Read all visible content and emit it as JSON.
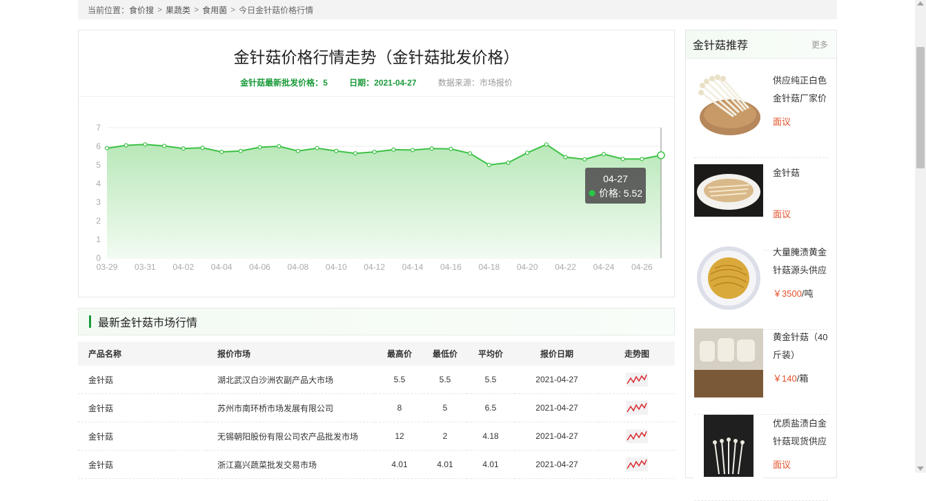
{
  "breadcrumb": {
    "prefix": "当前位置：",
    "items": [
      "食价搜",
      "果蔬类",
      "食用菌",
      "今日金针菇价格行情"
    ],
    "separator": ">"
  },
  "chart_panel": {
    "title": "金针菇价格行情走势（金针菇批发价格）",
    "latest_label": "金针菇最新批发价格：5",
    "date_label": "日期：2021-04-27",
    "source_label": "数据来源：市场报价"
  },
  "chart_data": {
    "type": "area",
    "x": [
      "03-29",
      "03-30",
      "03-31",
      "04-01",
      "04-02",
      "04-03",
      "04-04",
      "04-05",
      "04-06",
      "04-07",
      "04-08",
      "04-09",
      "04-10",
      "04-11",
      "04-12",
      "04-13",
      "04-14",
      "04-15",
      "04-16",
      "04-17",
      "04-18",
      "04-19",
      "04-20",
      "04-21",
      "04-22",
      "04-23",
      "04-24",
      "04-25",
      "04-26",
      "04-27"
    ],
    "x_tick_labels": [
      "03-29",
      "03-31",
      "04-02",
      "04-04",
      "04-06",
      "04-08",
      "04-10",
      "04-12",
      "04-14",
      "04-16",
      "04-18",
      "04-20",
      "04-22",
      "04-24",
      "04-26"
    ],
    "series": [
      {
        "values": [
          5.9,
          6.05,
          6.1,
          6.02,
          5.88,
          5.92,
          5.7,
          5.75,
          5.95,
          6.0,
          5.75,
          5.9,
          5.75,
          5.62,
          5.7,
          5.82,
          5.8,
          5.88,
          5.86,
          5.62,
          5.0,
          5.12,
          5.65,
          6.1,
          5.42,
          5.3,
          5.58,
          5.32,
          5.32,
          5.52
        ]
      }
    ],
    "ylim": [
      0,
      7
    ],
    "y_ticks": [
      0,
      1,
      2,
      3,
      4,
      5,
      6,
      7
    ],
    "grid": true,
    "tooltip": {
      "date": "04-27",
      "label": "价格: 5.52"
    },
    "colors": {
      "line": "#3bc144",
      "fill_top": "#b9e8b9",
      "fill_bottom": "#f2fbf2",
      "tooltip_bg": "#5a5a5a",
      "tooltip_dot": "#28c745"
    }
  },
  "market": {
    "title": "最新金针菇市场行情",
    "columns": [
      "产品名称",
      "报价市场",
      "最高价",
      "最低价",
      "平均价",
      "报价日期",
      "走势图"
    ],
    "rows": [
      [
        "金针菇",
        "湖北武汉白沙洲农副产品大市场",
        "5.5",
        "5.5",
        "5.5",
        "2021-04-27"
      ],
      [
        "金针菇",
        "苏州市南环桥市场发展有限公司",
        "8",
        "5",
        "6.5",
        "2021-04-27"
      ],
      [
        "金针菇",
        "无锡朝阳股份有限公司农产品批发市场",
        "12",
        "2",
        "4.18",
        "2021-04-27"
      ],
      [
        "金针菇",
        "浙江嘉兴蔬菜批发交易市场",
        "4.01",
        "4.01",
        "4.01",
        "2021-04-27"
      ]
    ],
    "trend_icon": "trend-chart-icon"
  },
  "sidebar": {
    "title": "金针菇推荐",
    "more": "更多",
    "products": [
      {
        "name": "供应纯正白色金针菇厂家价",
        "price": "面议",
        "unit": "",
        "image_icon": "enoki-basket-image"
      },
      {
        "name": "金针菇",
        "price": "面议",
        "unit": "",
        "image_icon": "enoki-plate-image"
      },
      {
        "name": "大量腌渍黄金针菇源头供应",
        "price": "￥3500",
        "unit": "/吨",
        "image_icon": "pickled-enoki-image"
      },
      {
        "name": "黄金针菇（40斤装）",
        "price": "￥140",
        "unit": "/箱",
        "image_icon": "boxed-enoki-image"
      },
      {
        "name": "优质盐渍白金针菇现货供应",
        "price": "面议",
        "unit": "",
        "image_icon": "salted-enoki-image"
      }
    ]
  }
}
